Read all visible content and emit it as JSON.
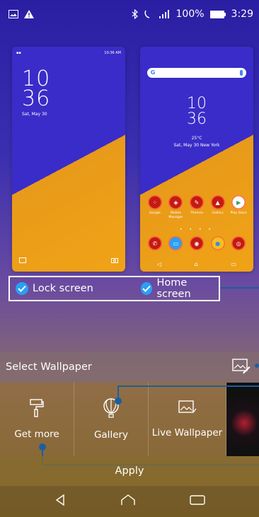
{
  "status_bar": {
    "battery": "100%",
    "time": "3:29"
  },
  "lock_preview": {
    "status_time": "10:36 AM",
    "hour": "10",
    "minute": "36",
    "date": "Sat, May 30"
  },
  "home_preview": {
    "hour": "10",
    "minute": "36",
    "weather": "25°C",
    "date_location": "Sat, May 30  New York",
    "apps_row1": [
      {
        "label": "Google",
        "icon": "google-folder-icon"
      },
      {
        "label": "Mobile Manager",
        "icon": "mobile-manager-icon"
      },
      {
        "label": "Themes",
        "icon": "themes-icon"
      },
      {
        "label": "Gallery",
        "icon": "gallery-icon"
      },
      {
        "label": "Play Store",
        "icon": "play-store-icon"
      }
    ],
    "apps_row2": [
      {
        "label": "",
        "icon": "phone-icon"
      },
      {
        "label": "",
        "icon": "messages-icon"
      },
      {
        "label": "",
        "icon": "camera-app-icon"
      },
      {
        "label": "",
        "icon": "chrome-icon"
      },
      {
        "label": "",
        "icon": "camera-icon"
      }
    ]
  },
  "targets": {
    "lock_label": "Lock screen",
    "home_label": "Home screen"
  },
  "select_wallpaper": {
    "title": "Select Wallpaper"
  },
  "options": [
    {
      "label": "Get more",
      "icon": "paint-roller-icon"
    },
    {
      "label": "Gallery",
      "icon": "balloon-icon"
    },
    {
      "label": "Live Wallpaper",
      "icon": "live-wallpaper-icon"
    }
  ],
  "apply_label": "Apply",
  "colors": {
    "accent": "#2a9ff5",
    "callout": "#1a5fa0",
    "app_red": "#c41a12"
  }
}
